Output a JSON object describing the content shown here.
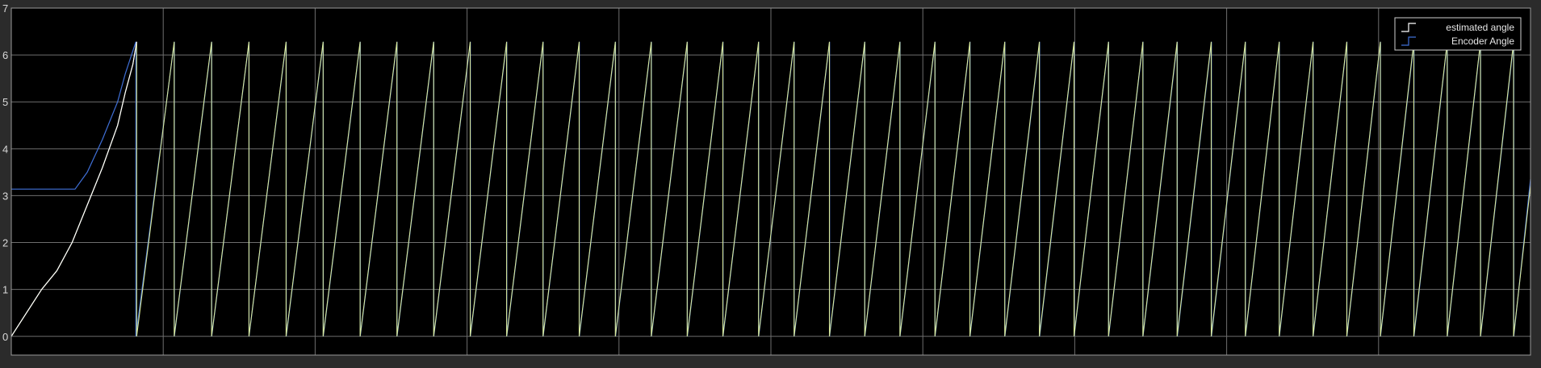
{
  "chart_data": {
    "type": "line",
    "title": "",
    "xlabel": "",
    "ylabel": "",
    "ylim": [
      -0.4,
      7
    ],
    "y_ticks": [
      "0",
      "1",
      "2",
      "3",
      "4",
      "5",
      "6",
      "7"
    ],
    "x_range": [
      0,
      10
    ],
    "x_gridlines": 10,
    "grid": true,
    "legend_position": "top-right",
    "colors": {
      "background": "#000000",
      "frame": "#2b2b2b",
      "grid": "#6e6e6e",
      "axis_text": "#d8d8d8",
      "estimated": "#ffffff",
      "encoder": "#3f6fd6",
      "overlap": "#d9e89a"
    },
    "series": [
      {
        "name": "estimated angle",
        "color": "#ffffff",
        "description_points": {
          "initial_ramp": [
            [
              0,
              0
            ],
            [
              0.1,
              0.5
            ],
            [
              0.2,
              1.0
            ],
            [
              0.3,
              1.4
            ],
            [
              0.4,
              2.0
            ],
            [
              0.5,
              2.8
            ],
            [
              0.6,
              3.6
            ],
            [
              0.7,
              4.5
            ],
            [
              0.75,
              5.2
            ],
            [
              0.8,
              5.8
            ],
            [
              0.825,
              6.28
            ]
          ],
          "sawtooth_period_start": 1.07,
          "sawtooth_period_end": 0.94,
          "wrap_min": 0,
          "wrap_max": 6.28
        }
      },
      {
        "name": "Encoder Angle",
        "color": "#3f6fd6",
        "description_points": {
          "initial_flat": [
            [
              0,
              3.14
            ],
            [
              0.42,
              3.14
            ]
          ],
          "initial_ramp": [
            [
              0.42,
              3.14
            ],
            [
              0.5,
              3.5
            ],
            [
              0.6,
              4.2
            ],
            [
              0.7,
              5.0
            ],
            [
              0.75,
              5.6
            ],
            [
              0.82,
              6.28
            ]
          ],
          "sawtooth_period_start": 1.07,
          "sawtooth_period_end": 0.94,
          "wrap_min": 0,
          "wrap_max": 6.28
        }
      }
    ]
  },
  "legend": {
    "items": [
      {
        "label": "estimated angle",
        "color": "#ffffff"
      },
      {
        "label": "Encoder Angle",
        "color": "#3f6fd6"
      }
    ]
  }
}
